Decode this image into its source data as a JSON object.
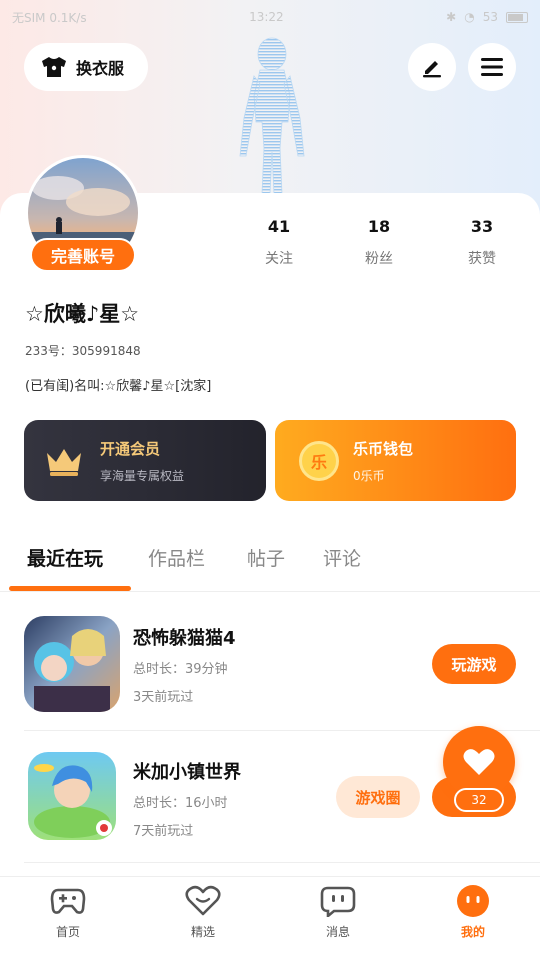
{
  "status_bar": {
    "left": "无SIM 0.1K/s",
    "time": "13:22",
    "battery": "53"
  },
  "header": {
    "outfit_label": "换衣服",
    "outfit_icon": "tshirt-icon",
    "edit_icon": "pen-icon",
    "menu_icon": "hamburger-icon"
  },
  "profile": {
    "complete_label": "完善账号",
    "stats": [
      {
        "value": "41",
        "label": "关注"
      },
      {
        "value": "18",
        "label": "粉丝"
      },
      {
        "value": "33",
        "label": "获赞"
      }
    ],
    "nickname": "☆欣曦♪星☆",
    "uid": "233号：305991848",
    "bio": "(已有闺)名叫:☆欣馨♪星☆[沈家]"
  },
  "vip": {
    "title": "开通会员",
    "subtitle": "享海量专属权益",
    "icon": "crown-icon"
  },
  "wallet": {
    "title": "乐币钱包",
    "subtitle": "0乐币",
    "coin_glyph": "乐"
  },
  "tabs": [
    {
      "label": "最近在玩",
      "active": true
    },
    {
      "label": "作品栏",
      "active": false
    },
    {
      "label": "帖子",
      "active": false
    },
    {
      "label": "评论",
      "active": false
    }
  ],
  "games": [
    {
      "name": "恐怖躲猫猫4",
      "total": "总时长：39分钟",
      "last_played": "3天前玩过",
      "play_label": "玩游戏"
    },
    {
      "name": "米加小镇世界",
      "total": "总时长：16小时",
      "last_played": "7天前玩过",
      "circle_label": "游戏圈",
      "play_label": "玩"
    }
  ],
  "fab": {
    "icon": "heart-icon",
    "count": "32"
  },
  "bottom_nav": [
    {
      "label": "首页",
      "icon": "gamepad-icon",
      "active": false
    },
    {
      "label": "精选",
      "icon": "heart-outline-icon",
      "active": false
    },
    {
      "label": "消息",
      "icon": "chat-icon",
      "active": false
    },
    {
      "label": "我的",
      "icon": "face-icon",
      "active": true
    }
  ],
  "colors": {
    "accent": "#ff6f0f",
    "vip_dark": "#2a2a33",
    "gold": "#f5c979"
  }
}
